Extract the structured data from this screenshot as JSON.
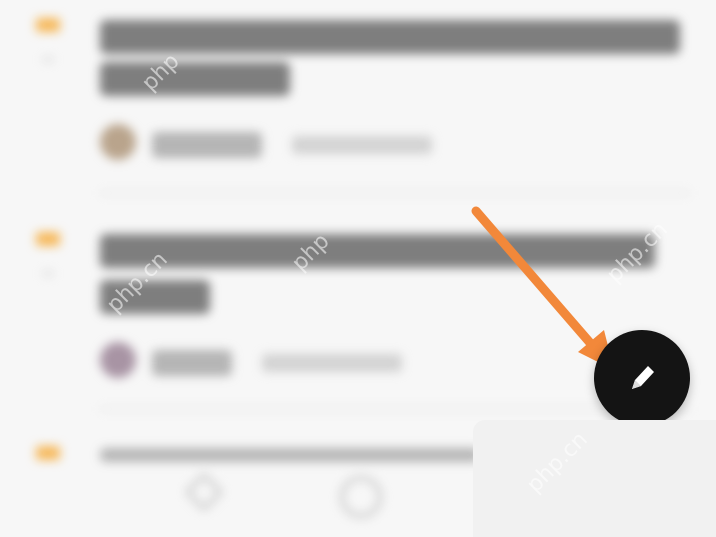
{
  "feed": {
    "posts": [
      {
        "title": "",
        "author": "",
        "time": ""
      },
      {
        "title": "",
        "author": "",
        "time": ""
      }
    ]
  },
  "fab": {
    "icon": "pen-icon"
  },
  "annotation": {
    "arrow_color": "#f2883a"
  },
  "colors": {
    "fab_bg": "#141414",
    "like_icon": "#f6b85a",
    "background": "#f7f7f7"
  }
}
